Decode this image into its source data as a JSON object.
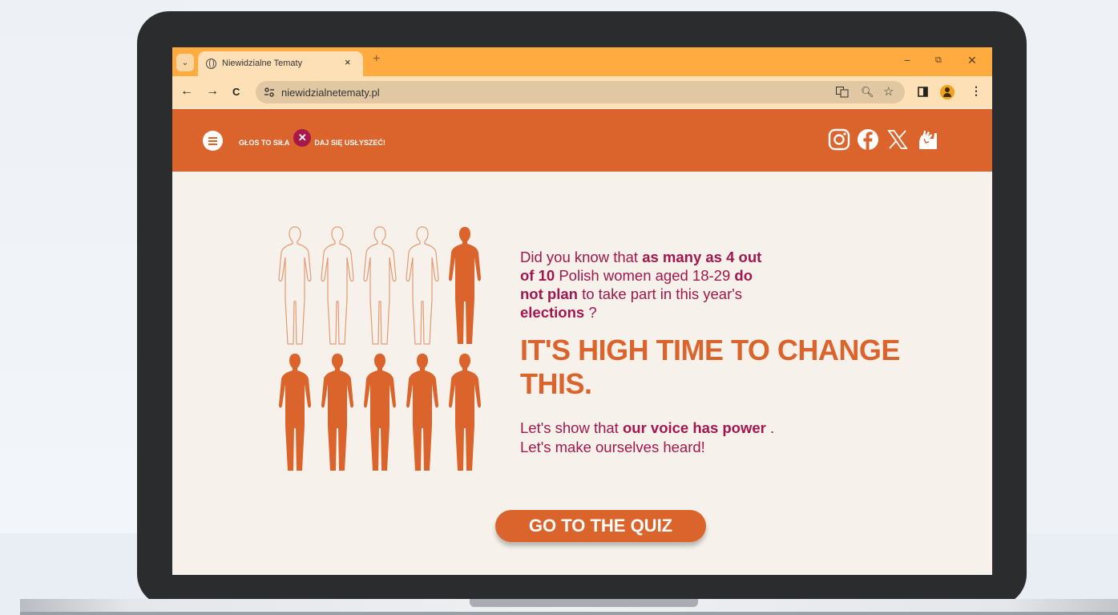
{
  "browser": {
    "tab_title": "Niewidzialne Tematy",
    "tab_close": "×",
    "new_tab": "+",
    "url": "niewidzialnetematy.pl",
    "win_min": "−",
    "win_max": "⧉",
    "win_close": "✕",
    "back": "←",
    "forward": "→",
    "reload": "C",
    "tab_dropdown": "⌄",
    "zoom_icon": "🔍︎",
    "star_icon": "☆",
    "menu_icon": "⋮"
  },
  "site": {
    "logo_left": "GŁOS TO SIŁA",
    "logo_x": "✕",
    "logo_right": "DAJ SIĘ USŁYSZEĆ!",
    "social": [
      "instagram-icon",
      "facebook-icon",
      "x-icon",
      "hand-icon"
    ],
    "question": {
      "p1": "Did you know that ",
      "b1": "as many as 4 out of 10",
      "p2": " Polish women aged 18-29 ",
      "b2": "do not plan",
      "p3": " to take part in this year's ",
      "b3": "elections",
      "p4": " ?"
    },
    "headline": "IT'S HIGH TIME TO CHANGE THIS.",
    "power": {
      "p1": "Let's show that ",
      "b1": "our voice has power",
      "p2": " .",
      "line2": "Let's make ourselves heard!"
    },
    "figures_total": 10,
    "figures_filled": 6,
    "quiz_button": "GO TO THE QUIZ"
  },
  "colors": {
    "accent_orange": "#db642c",
    "accent_crimson": "#a3164d",
    "chrome_orange": "#ffab40",
    "page_bg": "#f6f2eb"
  }
}
